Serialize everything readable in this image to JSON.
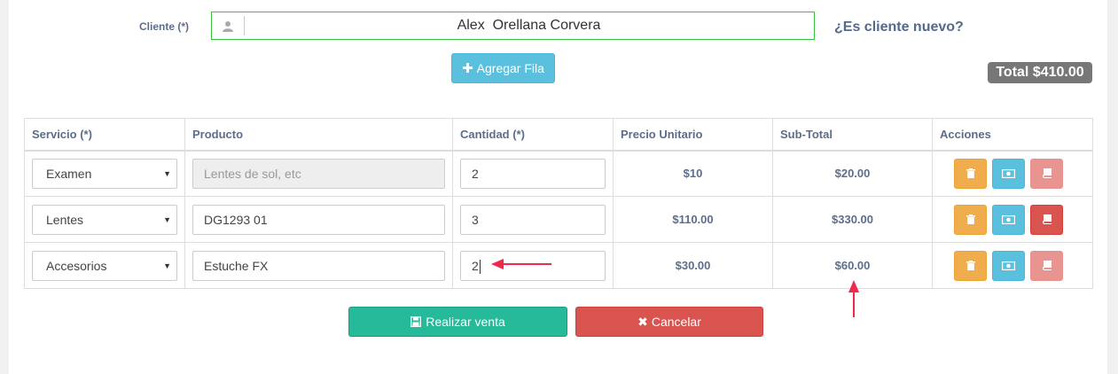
{
  "client": {
    "label": "Cliente (*)",
    "value": "Alex  Orellana Corvera",
    "new_client_link": "¿Es cliente nuevo?"
  },
  "add_row_label": "Agregar Fila",
  "total_label": "Total $410.00",
  "table": {
    "headers": [
      "Servicio (*)",
      "Producto",
      "Cantidad (*)",
      "Precio Unitario",
      "Sub-Total",
      "Acciones"
    ],
    "rows": [
      {
        "service": "Examen",
        "product": "",
        "product_placeholder": "Lentes de sol, etc",
        "quantity": "2",
        "unit_price": "$10",
        "subtotal": "$20.00"
      },
      {
        "service": "Lentes",
        "product": "DG1293 01",
        "quantity": "3",
        "unit_price": "$110.00",
        "subtotal": "$330.00"
      },
      {
        "service": "Accesorios",
        "product": "Estuche FX",
        "quantity": "2",
        "unit_price": "$30.00",
        "subtotal": "$60.00"
      }
    ]
  },
  "footer": {
    "submit_label": "Realizar venta",
    "cancel_label": "Cancelar"
  },
  "colors": {
    "accent_success": "#26b99a",
    "danger": "#d9534f",
    "info": "#5bc0de",
    "warning": "#f0ad4e",
    "annotation": "#f0284a"
  },
  "icons": [
    "user-icon",
    "plus-icon",
    "trash-icon",
    "money-icon",
    "book-icon",
    "save-icon",
    "times-icon"
  ]
}
